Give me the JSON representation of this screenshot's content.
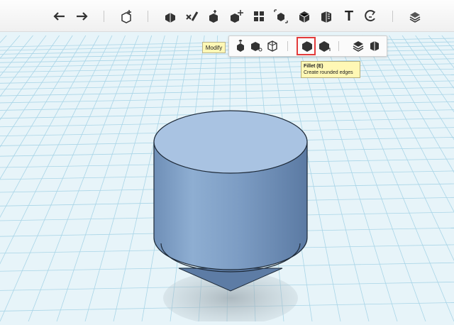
{
  "toolbar": {
    "buttons": [
      {
        "name": "undo-icon"
      },
      {
        "name": "redo-icon"
      },
      {
        "name": "add-primitive-icon"
      },
      {
        "name": "sketch-icon"
      },
      {
        "name": "construct-icon"
      },
      {
        "name": "modify-icon"
      },
      {
        "name": "transform-icon"
      },
      {
        "name": "pattern-icon"
      },
      {
        "name": "grouping-icon"
      },
      {
        "name": "combine-icon"
      },
      {
        "name": "measure-icon"
      },
      {
        "name": "text-icon"
      },
      {
        "name": "snap-icon"
      },
      {
        "name": "material-icon"
      }
    ],
    "text_tool_label": "T"
  },
  "modify_label": "Modify",
  "modify_toolbar": {
    "buttons": [
      {
        "name": "press-pull-icon"
      },
      {
        "name": "tweak-icon"
      },
      {
        "name": "split-face-icon"
      },
      {
        "name": "fillet-icon",
        "active": true
      },
      {
        "name": "chamfer-icon"
      },
      {
        "name": "split-solid-icon"
      },
      {
        "name": "shell-icon"
      }
    ]
  },
  "tooltip": {
    "title": "Fillet (E)",
    "description": "Create rounded edges"
  },
  "colors": {
    "grid_background": "#e7f4f9",
    "grid_line": "#9fd0e3",
    "solid_fill": "#7c9cc3",
    "highlight": "#e23a3a",
    "tooltip_bg": "#fff8b5"
  }
}
